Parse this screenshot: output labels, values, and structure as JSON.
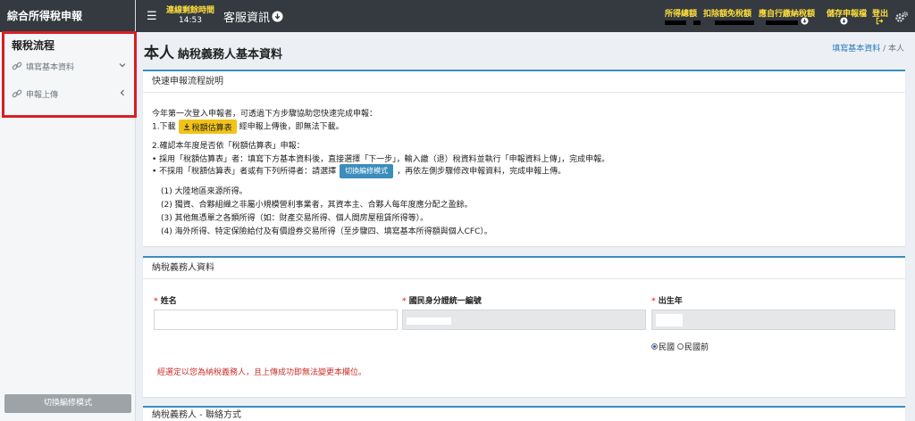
{
  "sidebar": {
    "brand": "綜合所得稅申報",
    "flow_title": "報稅流程",
    "items": [
      {
        "label": "填寫基本資料",
        "icon": "link-icon",
        "chevron": "chevron-down-icon"
      },
      {
        "label": "申報上傳",
        "icon": "link-icon",
        "chevron": "chevron-left-icon"
      }
    ],
    "switch_mode": "切換編修模式",
    "highlight_color": "#d61f26"
  },
  "topbar": {
    "timer_label": "連線剩餘時間",
    "timer_value": "14:53",
    "service": "客服資訊",
    "links": [
      "所得總額",
      "扣除額免稅額",
      "應自行繳納稅額",
      "儲存申報檔",
      "登出"
    ]
  },
  "main": {
    "title": "本人",
    "subtitle": "納稅義務人基本資料",
    "breadcrumb": [
      "填寫基本資料",
      "本人"
    ],
    "quick_guide": {
      "header": "快速申報流程說明",
      "intro": "今年第一次登入申報者，可透過下方步驟協助您快速完成申報：",
      "step1_pre": "1.下載",
      "download_button": "稅額估算表",
      "step1_post": "經申報上傳後，即無法下載。",
      "step2": "2.確認本年度是否依「稅額估算表」申報：",
      "bullet1": "• 採用「稅額估算表」者：填寫下方基本資料後，直接選擇「下一步」，輸入繳（退）稅資料並執行「申報資料上傳」，完成申報。",
      "bullet2_pre": "• 不採用「稅額估算表」者或有下列所得者：請選擇",
      "switch_button": "切換編修模式",
      "bullet2_post": "，再依左側步驟修改申報資料，完成申報上傳。",
      "items": [
        "(1)  大陸地區來源所得。",
        "(2)  獨資、合夥組織之非屬小規模營利事業者，其資本主、合夥人每年度應分配之盈餘。",
        "(3)  其他無憑單之各類所得（如：財產交易所得、個人間房屋租賃所得等）。",
        "(4)  海外所得、特定保險給付及有價證券交易所得（至步驟四、填寫基本所得額與個人CFC）。"
      ]
    },
    "taxpayer": {
      "header": "納稅義務人資料",
      "name_label": "姓名",
      "name_value": "",
      "id_label": "國民身分證統一編號",
      "birth_label": "出生年",
      "era_options": [
        "民國",
        "民國前"
      ],
      "era_selected": "民國",
      "warning": "經選定以您為納稅義務人，且上傳成功即無法變更本欄位。"
    },
    "contact": {
      "header": "納稅義務人 - 聯絡方式"
    }
  }
}
